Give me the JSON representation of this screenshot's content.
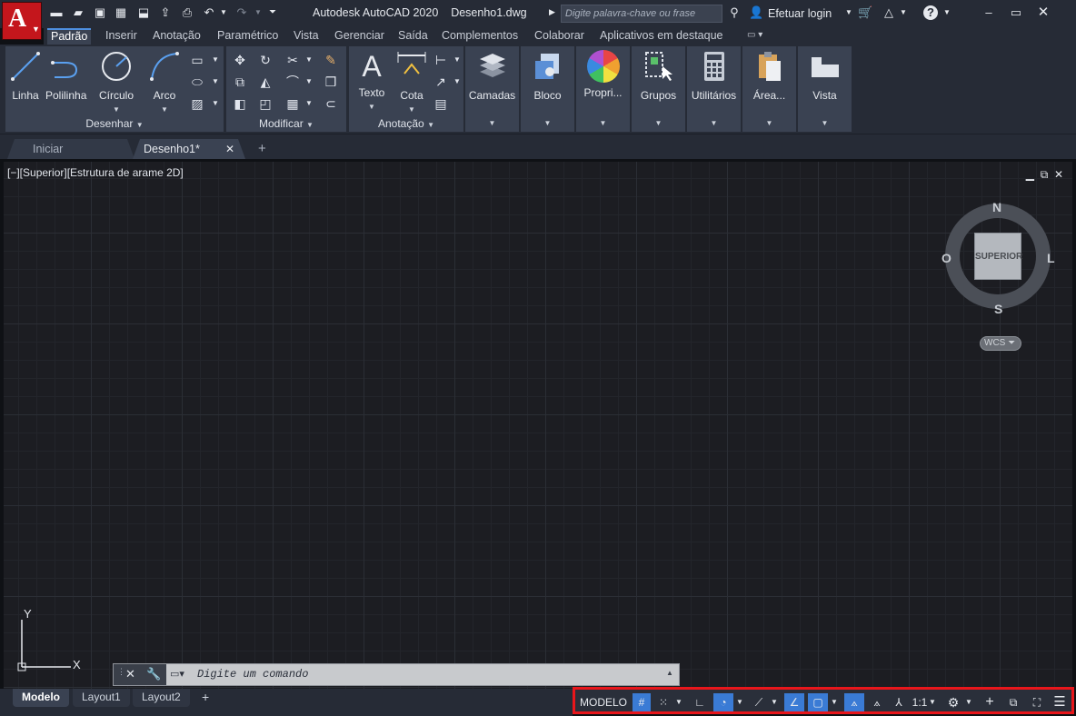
{
  "window": {
    "title": "Autodesk AutoCAD 2020",
    "filename": "Desenho1.dwg",
    "search_placeholder": "Digite palavra-chave ou frase",
    "login": "Efetuar login"
  },
  "app_logo": "A",
  "ribbon_tabs": [
    "Padrão",
    "Inserir",
    "Anotação",
    "Paramétrico",
    "Vista",
    "Gerenciar",
    "Saída",
    "Complementos",
    "Colaborar",
    "Aplicativos em destaque"
  ],
  "panels": {
    "desenhar": {
      "title": "Desenhar",
      "tools": [
        "Linha",
        "Polilinha",
        "Círculo",
        "Arco"
      ]
    },
    "modificar": {
      "title": "Modificar"
    },
    "anotacao": {
      "title": "Anotação",
      "tools": [
        "Texto",
        "Cota"
      ]
    },
    "big_tools": [
      "Camadas",
      "Bloco",
      "Propri...",
      "Grupos",
      "Utilitários",
      "Área...",
      "Vista"
    ]
  },
  "doc_tabs": [
    "Iniciar",
    "Desenho1*"
  ],
  "viewport": {
    "label": "[−][Superior][Estrutura de arame 2D]",
    "compass": {
      "n": "N",
      "s": "S",
      "e": "L",
      "w": "O",
      "face": "SUPERIOR",
      "ucs": "WCS"
    },
    "axis_x": "X",
    "axis_y": "Y"
  },
  "command": {
    "placeholder": "Digite um comando"
  },
  "layout_tabs": [
    "Modelo",
    "Layout1",
    "Layout2"
  ],
  "status": {
    "model": "MODELO",
    "scale": "1:1"
  },
  "colors": {
    "accent": "#e8161b",
    "logo": "#c4161c",
    "ribbon": "#3a4252",
    "bg": "#262b36"
  }
}
